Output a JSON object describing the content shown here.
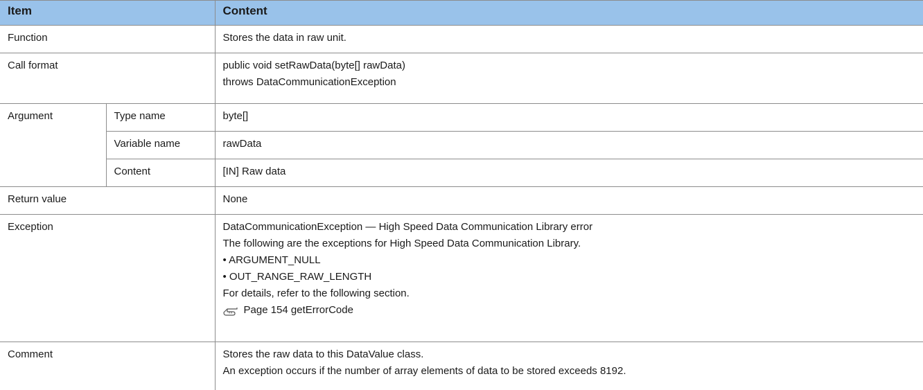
{
  "header": {
    "item": "Item",
    "content": "Content"
  },
  "rows": {
    "function": {
      "label": "Function",
      "lines": [
        "Stores the data in raw unit."
      ]
    },
    "call_format": {
      "label": "Call format",
      "lines": [
        "public void setRawData(byte[] rawData)",
        "throws DataCommunicationException"
      ]
    },
    "argument": {
      "label": "Argument",
      "type_name": {
        "label": "Type name",
        "value": "byte[]"
      },
      "variable_name": {
        "label": "Variable name",
        "value": "rawData"
      },
      "content": {
        "label": "Content",
        "value": "[IN] Raw data"
      }
    },
    "return_value": {
      "label": "Return value",
      "value": "None"
    },
    "exception": {
      "label": "Exception",
      "lines": [
        "DataCommunicationException — High Speed Data Communication Library error",
        "The following are the exceptions for High Speed Data Communication Library."
      ],
      "bullets": [
        "• ARGUMENT_NULL",
        "• OUT_RANGE_RAW_LENGTH"
      ],
      "details": "For details, refer to the following section.",
      "reference": {
        "icon": "page-reference-icon",
        "text": "Page 154 getErrorCode"
      }
    },
    "comment": {
      "label": "Comment",
      "lines": [
        "Stores the raw data to this DataValue class.",
        "An exception occurs if the number of array elements of data to be stored exceeds 8192."
      ]
    }
  },
  "colors": {
    "header_bg": "#99c2ea",
    "border": "#8c8c8c"
  }
}
